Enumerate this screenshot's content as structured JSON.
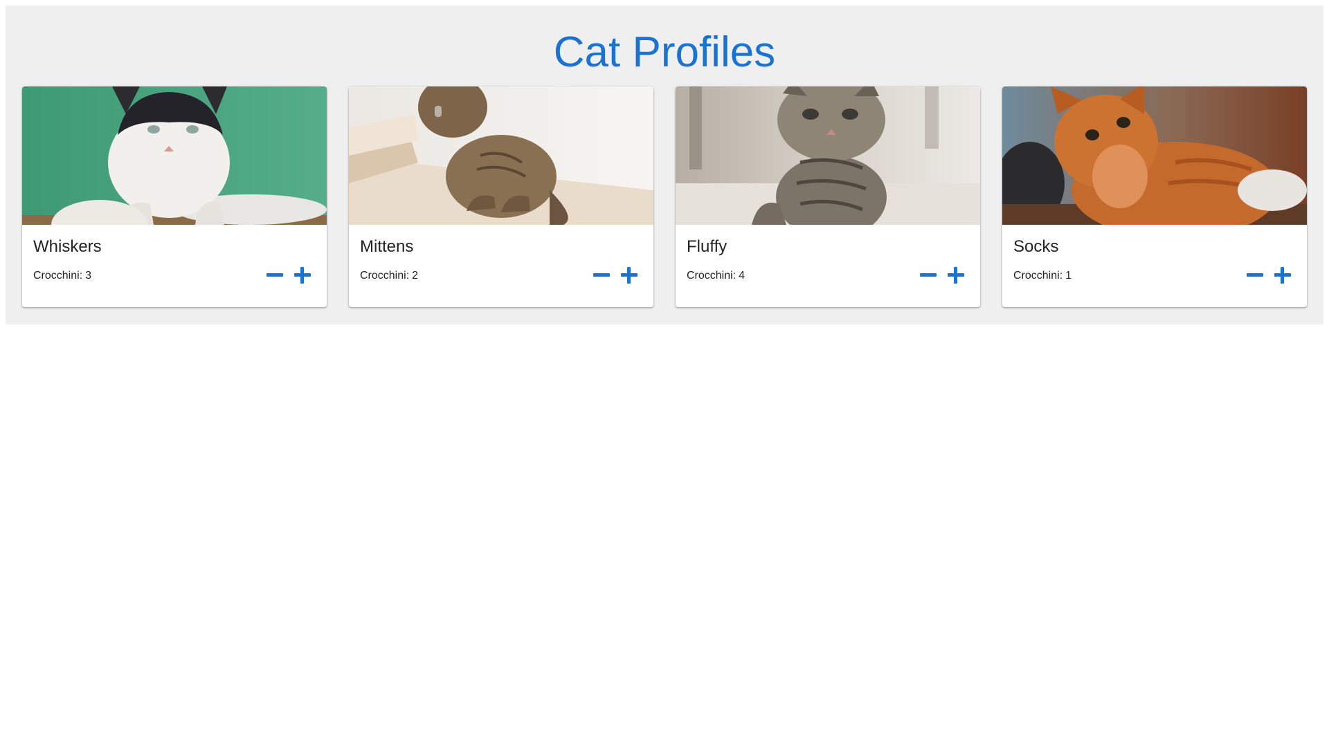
{
  "title": "Cat Profiles",
  "colors": {
    "accent": "#1a73d0",
    "panel_bg": "#efefef",
    "text": "#222222"
  },
  "count_label": "Crocchini:",
  "icons": {
    "decrement": "minus-icon",
    "increment": "plus-icon"
  },
  "cats": [
    {
      "name": "Whiskers",
      "count": "3",
      "photo": "black-and-white cat lying on a green background"
    },
    {
      "name": "Mittens",
      "count": "2",
      "photo": "brown tabby cat sitting on stairs"
    },
    {
      "name": "Fluffy",
      "count": "4",
      "photo": "grey tabby kitten"
    },
    {
      "name": "Socks",
      "count": "1",
      "photo": "orange long-haired cat looking up"
    }
  ]
}
